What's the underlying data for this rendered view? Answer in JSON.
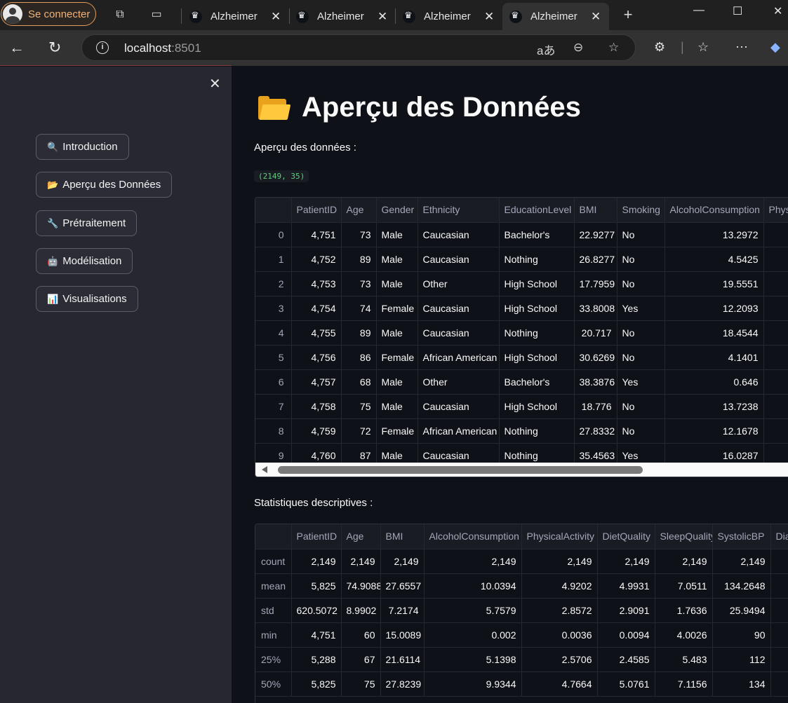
{
  "browser": {
    "signin_label": "Se connecter",
    "tabs": [
      {
        "title": "Alzheimer Dis"
      },
      {
        "title": "Alzheimer Dis"
      },
      {
        "title": "Alzheimer Dis"
      },
      {
        "title": "Alzheimer Dis"
      }
    ],
    "url_host": "localhost",
    "url_port": ":8501"
  },
  "sidebar": {
    "items": [
      {
        "icon": "🔍",
        "label": "Introduction"
      },
      {
        "icon": "📂",
        "label": "Aperçu des Données"
      },
      {
        "icon": "🔧",
        "label": "Prétraitement"
      },
      {
        "icon": "🤖",
        "label": "Modélisation"
      },
      {
        "icon": "📊",
        "label": "Visualisations"
      }
    ]
  },
  "main": {
    "title": "Aperçu des Données",
    "preview_label": "Aperçu des données :",
    "shape": "(2149, 35)",
    "stats_label": "Statistiques descriptives :"
  },
  "preview_table": {
    "columns": [
      "",
      "PatientID",
      "Age",
      "Gender",
      "Ethnicity",
      "EducationLevel",
      "BMI",
      "Smoking",
      "AlcoholConsumption",
      "PhysicalActivity"
    ],
    "rows": [
      [
        "0",
        "4,751",
        "73",
        "Male",
        "Caucasian",
        "Bachelor's",
        "22.9277",
        "No",
        "13.2972",
        ""
      ],
      [
        "1",
        "4,752",
        "89",
        "Male",
        "Caucasian",
        "Nothing",
        "26.8277",
        "No",
        "4.5425",
        ""
      ],
      [
        "2",
        "4,753",
        "73",
        "Male",
        "Other",
        "High School",
        "17.7959",
        "No",
        "19.5551",
        ""
      ],
      [
        "3",
        "4,754",
        "74",
        "Female",
        "Caucasian",
        "High School",
        "33.8008",
        "Yes",
        "12.2093",
        ""
      ],
      [
        "4",
        "4,755",
        "89",
        "Male",
        "Caucasian",
        "Nothing",
        "20.717",
        "No",
        "18.4544",
        ""
      ],
      [
        "5",
        "4,756",
        "86",
        "Female",
        "African American",
        "High School",
        "30.6269",
        "No",
        "4.1401",
        ""
      ],
      [
        "6",
        "4,757",
        "68",
        "Male",
        "Other",
        "Bachelor's",
        "38.3876",
        "Yes",
        "0.646",
        ""
      ],
      [
        "7",
        "4,758",
        "75",
        "Male",
        "Caucasian",
        "High School",
        "18.776",
        "No",
        "13.7238",
        ""
      ],
      [
        "8",
        "4,759",
        "72",
        "Female",
        "African American",
        "Nothing",
        "27.8332",
        "No",
        "12.1678",
        ""
      ],
      [
        "9",
        "4,760",
        "87",
        "Male",
        "Caucasian",
        "Nothing",
        "35.4563",
        "Yes",
        "16.0287",
        ""
      ]
    ]
  },
  "stats_table": {
    "columns": [
      "",
      "PatientID",
      "Age",
      "BMI",
      "AlcoholConsumption",
      "PhysicalActivity",
      "DietQuality",
      "SleepQuality",
      "SystolicBP",
      "DiastolicBP"
    ],
    "rows": [
      [
        "count",
        "2,149",
        "2,149",
        "2,149",
        "2,149",
        "2,149",
        "2,149",
        "2,149",
        "2,149",
        ""
      ],
      [
        "mean",
        "5,825",
        "74.9088",
        "27.6557",
        "10.0394",
        "4.9202",
        "4.9931",
        "7.0511",
        "134.2648",
        ""
      ],
      [
        "std",
        "620.5072",
        "8.9902",
        "7.2174",
        "5.7579",
        "2.8572",
        "2.9091",
        "1.7636",
        "25.9494",
        ""
      ],
      [
        "min",
        "4,751",
        "60",
        "15.0089",
        "0.002",
        "0.0036",
        "0.0094",
        "4.0026",
        "90",
        ""
      ],
      [
        "25%",
        "5,288",
        "67",
        "21.6114",
        "5.1398",
        "2.5706",
        "2.4585",
        "5.483",
        "112",
        ""
      ],
      [
        "50%",
        "5,825",
        "75",
        "27.8239",
        "9.9344",
        "4.7664",
        "5.0761",
        "7.1156",
        "134",
        ""
      ]
    ]
  }
}
